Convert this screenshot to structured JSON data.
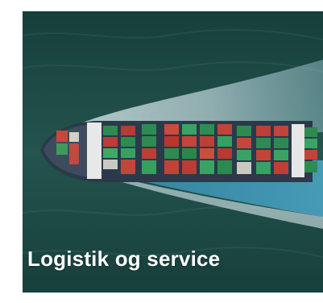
{
  "tile": {
    "caption": "Logistik og service",
    "image_subject": "aerial-container-ship-photo",
    "colors": {
      "sea": "#1f4a44",
      "wake": "#dfeef2",
      "hull": "#2a3a4a",
      "text": "#ffffff"
    }
  }
}
